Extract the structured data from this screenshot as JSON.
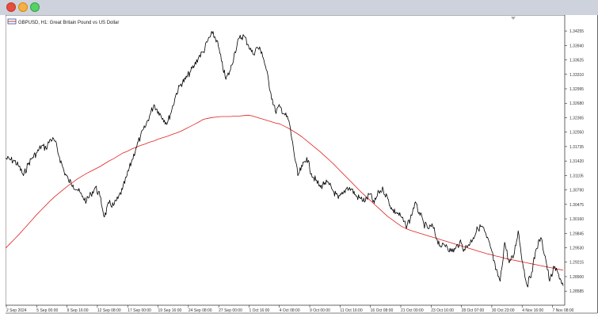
{
  "window": {
    "controls": [
      "close",
      "minimize",
      "maximize"
    ],
    "colors": {
      "close": "#e74c3c",
      "minimize": "#f5b041",
      "maximize": "#58d068"
    }
  },
  "chart_header": {
    "symbol_label": "GBPUSD, H1:  Great Britain Pound vs US Dollar",
    "icon": "chart-flag-icon"
  },
  "chart_data": {
    "type": "line",
    "price_scale": [
      "1.34255",
      "1.33940",
      "1.33625",
      "1.33310",
      "1.32995",
      "1.32680",
      "1.32365",
      "1.32050",
      "1.31735",
      "1.31420",
      "1.31105",
      "1.30790",
      "1.30475",
      "1.30160",
      "1.29845",
      "1.29530",
      "1.29215",
      "1.28900",
      "1.28585"
    ],
    "time_labels": [
      "2 Sep 2024",
      "5 Sep 00:00",
      "9 Sep 16:00",
      "12 Sep 08:00",
      "17 Sep 00:00",
      "19 Sep 16:00",
      "24 Sep 08:00",
      "27 Sep 00:00",
      "1 Oct 16:00",
      "4 Oct 08:00",
      "9 Oct 00:00",
      "11 Oct 16:00",
      "16 Oct 08:00",
      "21 Oct 00:00",
      "23 Oct 16:00",
      "28 Oct 07:00",
      "30 Oct 23:00",
      "4 Nov 16:00",
      "7 Nov 08:00"
    ],
    "ylim": [
      1.2845,
      1.3436
    ],
    "series": [
      {
        "color": "#000000",
        "values": [
          1.3148,
          1.3145,
          1.3142,
          1.313,
          1.311,
          1.3135,
          1.315,
          1.316,
          1.3175,
          1.317,
          1.319,
          1.3185,
          1.315,
          1.312,
          1.31,
          1.309,
          1.308,
          1.3065,
          1.3055,
          1.307,
          1.3085,
          1.3065,
          1.302,
          1.305,
          1.3045,
          1.306,
          1.308,
          1.311,
          1.314,
          1.317,
          1.3195,
          1.3215,
          1.324,
          1.3265,
          1.325,
          1.3235,
          1.3225,
          1.3255,
          1.329,
          1.331,
          1.332,
          1.3335,
          1.335,
          1.337,
          1.338,
          1.3405,
          1.342,
          1.3405,
          1.336,
          1.332,
          1.334,
          1.338,
          1.341,
          1.3415,
          1.3395,
          1.3375,
          1.339,
          1.338,
          1.334,
          1.329,
          1.325,
          1.326,
          1.3245,
          1.323,
          1.317,
          1.311,
          1.313,
          1.315,
          1.3115,
          1.31,
          1.3085,
          1.3095,
          1.309,
          1.3075,
          1.306,
          1.307,
          1.3085,
          1.308,
          1.3065,
          1.306,
          1.3055,
          1.307,
          1.305,
          1.3075,
          1.308,
          1.306,
          1.3035,
          1.303,
          1.302,
          1.3,
          1.3015,
          1.305,
          1.303,
          1.3005,
          1.2995,
          1.3,
          1.297,
          1.2955,
          1.296,
          1.2945,
          1.295,
          1.2965,
          1.295,
          1.296,
          1.2975,
          1.2995,
          1.3,
          1.2975,
          1.295,
          1.2905,
          1.288,
          1.2965,
          1.292,
          1.2935,
          1.299,
          1.292,
          1.287,
          1.29,
          1.295,
          1.2975,
          1.2935,
          1.288,
          1.291,
          1.2895,
          1.287
        ]
      },
      {
        "color": "#e02020",
        "values": [
          1.2952,
          1.2962,
          1.2972,
          1.2982,
          1.2993,
          1.3004,
          1.3015,
          1.3026,
          1.3036,
          1.3046,
          1.3056,
          1.3065,
          1.3073,
          1.3081,
          1.3089,
          1.3096,
          1.3103,
          1.3109,
          1.3115,
          1.312,
          1.3125,
          1.313,
          1.3136,
          1.3142,
          1.3147,
          1.3153,
          1.3159,
          1.3163,
          1.3168,
          1.3172,
          1.3176,
          1.3179,
          1.3183,
          1.3186,
          1.319,
          1.3193,
          1.3196,
          1.32,
          1.3203,
          1.3207,
          1.3212,
          1.3217,
          1.3222,
          1.3227,
          1.3233,
          1.3235,
          1.3237,
          1.3238,
          1.3239,
          1.3239,
          1.3239,
          1.324,
          1.324,
          1.3241,
          1.3242,
          1.324,
          1.3237,
          1.3234,
          1.3231,
          1.3228,
          1.3225,
          1.3223,
          1.3218,
          1.3213,
          1.3207,
          1.3201,
          1.3194,
          1.3186,
          1.3178,
          1.317,
          1.3162,
          1.3153,
          1.3144,
          1.3135,
          1.3125,
          1.3115,
          1.3105,
          1.3095,
          1.3085,
          1.3075,
          1.3066,
          1.3057,
          1.3048,
          1.3039,
          1.303,
          1.3021,
          1.3014,
          1.3007,
          1.3,
          1.2995,
          1.2991,
          1.2988,
          1.2985,
          1.2982,
          1.2979,
          1.2976,
          1.2973,
          1.297,
          1.2967,
          1.2964,
          1.2961,
          1.2958,
          1.2955,
          1.2952,
          1.2949,
          1.2946,
          1.2943,
          1.294,
          1.2938,
          1.2935,
          1.2933,
          1.293,
          1.2928,
          1.2926,
          1.2924,
          1.2922,
          1.292,
          1.2918,
          1.2916,
          1.2914,
          1.2912,
          1.291,
          1.2908,
          1.2906,
          1.2904
        ]
      }
    ]
  }
}
